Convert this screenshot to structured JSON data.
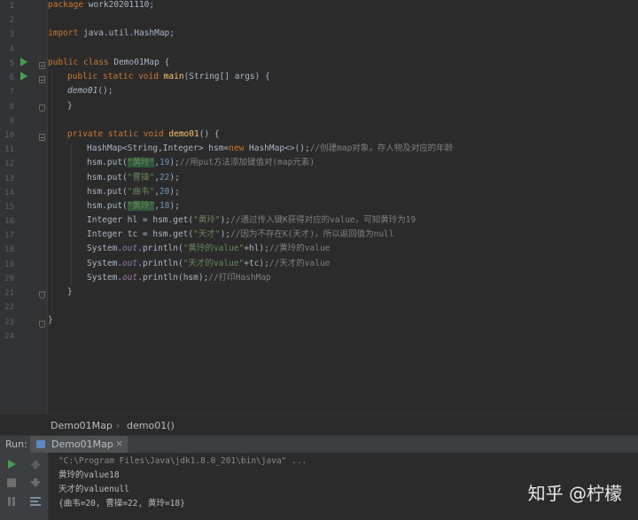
{
  "editor": {
    "line_numbers": [
      "1",
      "2",
      "3",
      "4",
      "5",
      "6",
      "7",
      "8",
      "9",
      "10",
      "11",
      "12",
      "13",
      "14",
      "15",
      "16",
      "17",
      "18",
      "19",
      "20",
      "21",
      "22",
      "23",
      "24"
    ],
    "lines": {
      "l1_pkg": "package",
      "l1_name": " work20201110;",
      "l3_imp": "import",
      "l3_name": " java.util.HashMap;",
      "l5_kw": "public class",
      "l5_cls": " Demo01Map {",
      "l6_kw": "public static void",
      "l6_main": " main",
      "l6_rest": "(String[] args) {",
      "l7_call": "demo01",
      "l7_rest": "();",
      "l8": "}",
      "l10_kw": "private static void",
      "l10_m": " demo01",
      "l10_rest": "() {",
      "l11_a": "HashMap<String,Integer> hsm=",
      "l11_new": "new",
      "l11_b": " HashMap<>();",
      "l11_c": "//创建map对象，存人物及对应的年龄",
      "l12_a": "hsm.put(",
      "l12_s": "\"黄玲\"",
      "l12_b": ",",
      "l12_n": "19",
      "l12_c2": ");",
      "l12_c": "//用put方法添加键值对(map元素)",
      "l13_a": "hsm.put(",
      "l13_s": "\"曹操\"",
      "l13_b": ",",
      "l13_n": "22",
      "l13_c2": ");",
      "l14_a": "hsm.put(",
      "l14_s": "\"曲韦\"",
      "l14_b": ",",
      "l14_n": "20",
      "l14_c2": ");",
      "l15_a": "hsm.put(",
      "l15_s": "\"黄玲\"",
      "l15_b": ",",
      "l15_n": "18",
      "l15_c2": ");",
      "l16_a": "Integer hl = hsm.get(",
      "l16_s": "\"黄玲\"",
      "l16_b": ");",
      "l16_c": "//通过传入键K获得对应的value，可知黄玲为19",
      "l17_a": "Integer tc = hsm.get(",
      "l17_s": "\"天才\"",
      "l17_b": ");",
      "l17_c": "//因为不存在K(天才)，所以返回值为null",
      "l18_a": "System.",
      "l18_out": "out",
      "l18_b": ".println(",
      "l18_s": "\"黄玲的value\"",
      "l18_d": "+hl);",
      "l18_c": "//黄玲的value",
      "l19_a": "System.",
      "l19_out": "out",
      "l19_b": ".println(",
      "l19_s": "\"天才的value\"",
      "l19_d": "+tc);",
      "l19_c": "//天才的value",
      "l20_a": "System.",
      "l20_out": "out",
      "l20_b": ".println(hsm);",
      "l20_c": "//打印HashMap",
      "l21": "}",
      "l23": "}"
    }
  },
  "breadcrumb": {
    "class": "Demo01Map",
    "sep": "›",
    "method": "demo01()"
  },
  "run": {
    "label": "Run:",
    "tab": "Demo01Map",
    "close": "×"
  },
  "console": {
    "cmd": "\"C:\\Program Files\\Java\\jdk1.8.0_201\\bin\\java\" ...",
    "out1": "黄玲的value18",
    "out2": "天才的valuenull",
    "out3": "{曲韦=20, 曹操=22, 黄玲=18}"
  },
  "watermark": "知乎 @柠檬",
  "colors": {
    "keyword": "#cc7832",
    "string": "#6a8759",
    "comment": "#808080",
    "method": "#ffc66d",
    "number": "#6897bb",
    "run_green": "#499c54"
  }
}
